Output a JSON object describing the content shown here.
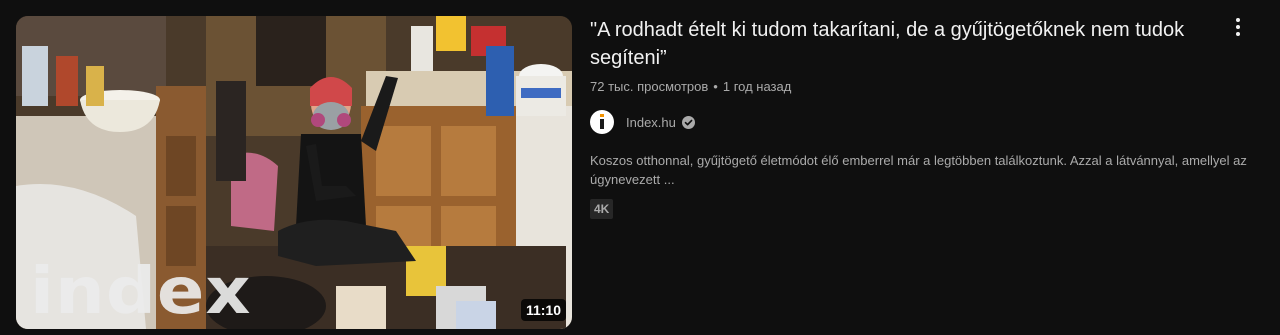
{
  "video": {
    "title": "\"A rodhadt ételt ki tudom takarítani, de a gyűjtögetőknek nem tudok segíteni”",
    "views": "72 тыс. просмотров",
    "separator": "•",
    "age": "1 год назад",
    "duration": "11:10",
    "thumbnail_watermark": "index",
    "channel": {
      "name": "Index.hu",
      "verified_icon": "verified-check-icon",
      "avatar_icon": "index-logo-icon"
    },
    "description": "Koszos otthonnal, gyűjtögető életmódot élő emberrel már a legtöbben találkoztunk. Azzal a látvánnyal, amellyel az úgynevezett ...",
    "badge": "4K"
  },
  "menu": {
    "icon": "more-vert-icon"
  },
  "colors": {
    "background": "#0f0f0f",
    "title": "#f1f1f1",
    "secondary_text": "#aaaaaa",
    "badge_bg": "#272727"
  }
}
